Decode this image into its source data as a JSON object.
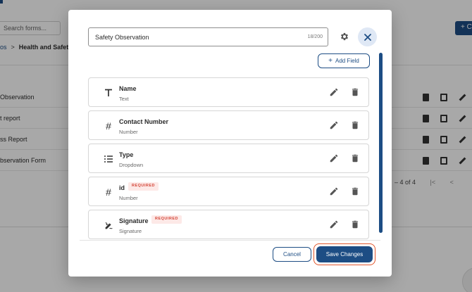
{
  "background": {
    "search_placeholder": "Search forms...",
    "breadcrumb": {
      "parent": "os",
      "current": "Health and Safety"
    },
    "add_button_label": "+ C",
    "rows": [
      {
        "label": "Observation"
      },
      {
        "label": "t report"
      },
      {
        "label": "ss Report"
      },
      {
        "label": "bservation Form"
      }
    ],
    "pagination": "– 4 of 4"
  },
  "modal": {
    "title_value": "Safety Observation",
    "title_count": "18/200",
    "add_field_label": "Add Field",
    "fields": [
      {
        "name": "Name",
        "type": "Text",
        "icon": "text-icon",
        "required": false
      },
      {
        "name": "Contact Number",
        "type": "Number",
        "icon": "hash-icon",
        "required": false
      },
      {
        "name": "Type",
        "type": "Dropdown",
        "icon": "list-icon",
        "required": false
      },
      {
        "name": "id",
        "type": "Number",
        "icon": "hash-icon",
        "required": true,
        "required_label": "REQUIRED"
      },
      {
        "name": "Signature",
        "type": "Signature",
        "icon": "signature-icon",
        "required": true,
        "required_label": "REQUIRED"
      }
    ],
    "cancel_label": "Cancel",
    "save_label": "Save Changes"
  },
  "colors": {
    "primary": "#1d4d84",
    "danger": "#d44638",
    "highlight": "#e2572e"
  }
}
